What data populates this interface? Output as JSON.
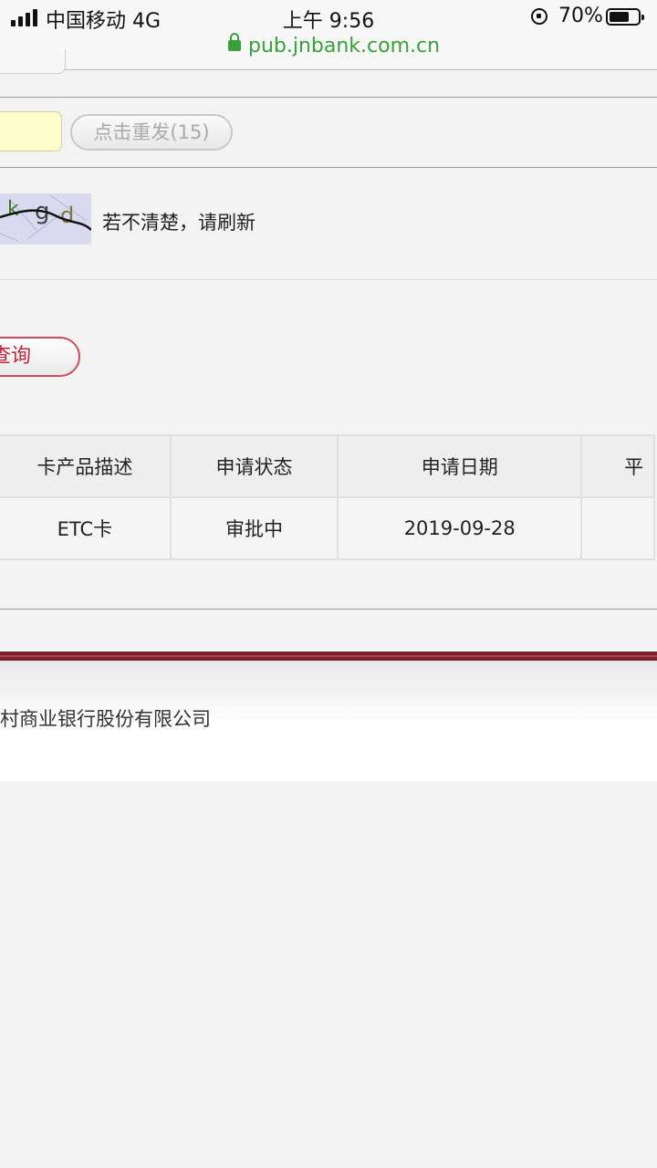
{
  "status_bar": {
    "carrier": "中国移动",
    "network": "4G",
    "time": "上午 9:56",
    "battery_percent": "70%",
    "battery_level": 0.7
  },
  "url_bar": {
    "url": "pub.jnbank.com.cn",
    "secure_color": "#3aa03a"
  },
  "verify": {
    "resend_label": "点击重发(15)",
    "captcha_hint": "若不清楚，请刷新"
  },
  "query": {
    "button_label": "查询"
  },
  "table": {
    "headers": [
      "卡产品描述",
      "申请状态",
      "申请日期",
      "平"
    ],
    "rows": [
      [
        "ETC卡",
        "审批中",
        "2019-09-28",
        ""
      ]
    ]
  },
  "footer": {
    "text": "村商业银行股份有限公司",
    "bar_color": "#7a1f2b"
  }
}
